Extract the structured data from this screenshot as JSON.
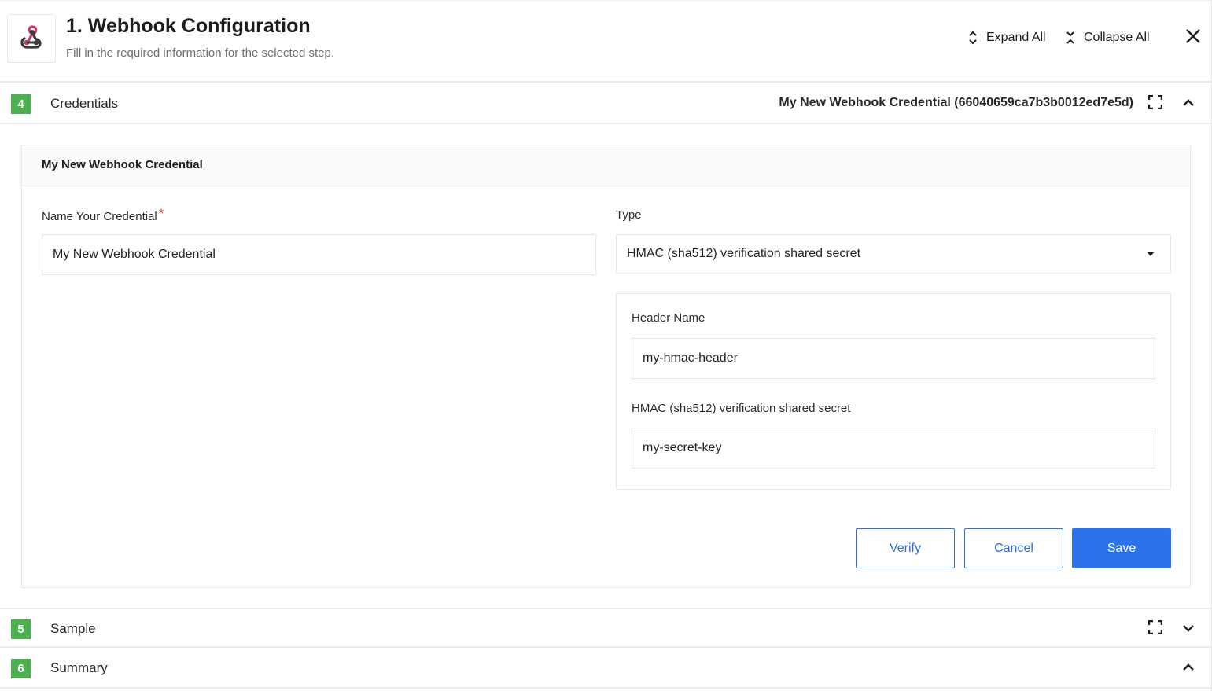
{
  "header": {
    "logo_icon": "webhook-icon",
    "title": "1. Webhook Configuration",
    "subtitle": "Fill in the required information for the selected step.",
    "expand_all_label": "Expand All",
    "expand_all_icon": "expand-vertical-icon",
    "collapse_all_label": "Collapse All",
    "collapse_all_icon": "collapse-vertical-icon",
    "close_icon": "close-icon"
  },
  "sections": [
    {
      "number": "4",
      "label": "Credentials",
      "selected_value": "My New Webhook Credential (66040659ca7b3b0012ed7e5d)",
      "expanded": true,
      "has_fullscreen": true
    },
    {
      "number": "5",
      "label": "Sample",
      "expanded": false,
      "has_fullscreen": true
    },
    {
      "number": "6",
      "label": "Summary",
      "expanded": true,
      "has_fullscreen": false
    }
  ],
  "credential_form": {
    "card_title": "My New Webhook Credential",
    "name_label": "Name Your Credential",
    "name_required_mark": "*",
    "name_value": "My New Webhook Credential",
    "type_label": "Type",
    "type_value": "HMAC (sha512) verification shared secret",
    "header_name_label": "Header Name",
    "header_name_value": "my-hmac-header",
    "secret_label": "HMAC (sha512) verification shared secret",
    "secret_value": "my-secret-key",
    "buttons": {
      "verify": "Verify",
      "cancel": "Cancel",
      "save": "Save"
    }
  },
  "colors": {
    "badge_green": "#4caf50",
    "primary_blue": "#2b72eb",
    "required_red": "#e53935",
    "webhook_pink": "#c73a63"
  }
}
